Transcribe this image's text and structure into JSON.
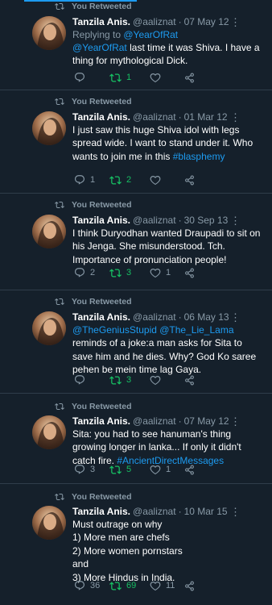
{
  "retweet_label": "You Retweeted",
  "tweets": [
    {
      "name": "Tanzila Anis.",
      "handle": "@aaliznat",
      "date": "07 May 12",
      "reply_prefix": "Replying to ",
      "reply_to": "@YearOfRat",
      "mention": "@YearOfRat",
      "text": " last time it was Shiva. I have a thing for mythological Dick.",
      "replies": "",
      "retweets": "1",
      "likes": ""
    },
    {
      "name": "Tanzila Anis.",
      "handle": "@aaliznat",
      "date": "01 Mar 12",
      "text": "I just saw this huge Shiva idol with legs spread wide. I want to stand under it. Who wants to join me in this ",
      "hashtag": "#blasphemy",
      "replies": "1",
      "retweets": "2",
      "likes": ""
    },
    {
      "name": "Tanzila Anis.",
      "handle": "@aaliznat",
      "date": "30 Sep 13",
      "text": "I think Duryodhan wanted Draupadi to sit on his Jenga. She misunderstood. Tch. Importance of pronunciation people!",
      "replies": "2",
      "retweets": "3",
      "likes": "1"
    },
    {
      "name": "Tanzila Anis.",
      "handle": "@aaliznat",
      "date": "06 May 13",
      "mention1": "@TheGeniusStupid",
      "mention2": "@The_Lie_Lama",
      "text": " reminds of a joke:a man asks for Sita to save him and he dies. Why? God Ko saree pehen be mein time lag Gaya.",
      "replies": "",
      "retweets": "3",
      "likes": ""
    },
    {
      "name": "Tanzila Anis.",
      "handle": "@aaliznat",
      "date": "07 May 12",
      "text": "Sita: you had to see hanuman's thing growing longer in lanka... If only it didn't catch fire. ",
      "hashtag": "#AncientDirectMessages",
      "replies": "3",
      "retweets": "5",
      "likes": "1"
    },
    {
      "name": "Tanzila Anis.",
      "handle": "@aaliznat",
      "date": "10 Mar 15",
      "lines": [
        "Must outrage on why",
        "1) More men are chefs",
        "2) More women pornstars",
        "and",
        "3) More Hindus in India."
      ],
      "replies": "36",
      "retweets": "69",
      "likes": "11"
    }
  ],
  "colors": {
    "background": "#15202b",
    "secondary_text": "#8899a6",
    "link": "#1d9bf0",
    "retweet_active": "#17bf63",
    "divider": "#2f3d4a"
  }
}
